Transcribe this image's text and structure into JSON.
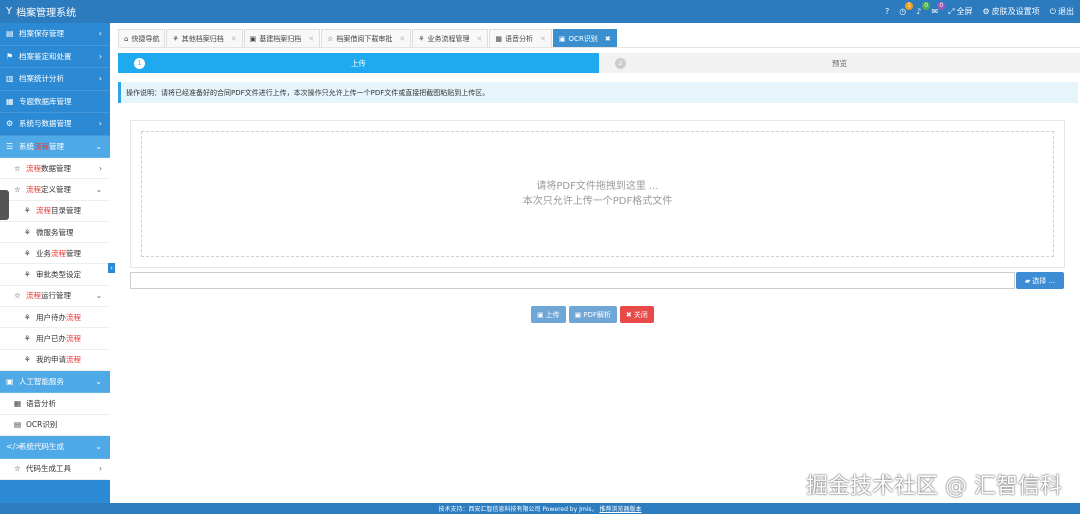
{
  "app": {
    "title": "档案管理系统",
    "logo_icon": "Y"
  },
  "topbar": {
    "items": [
      {
        "icon": "question-icon",
        "label": "",
        "badge": ""
      },
      {
        "icon": "clock-icon",
        "label": "",
        "badge": "1",
        "badge_color": "#f0a020"
      },
      {
        "icon": "bell-icon",
        "label": "",
        "badge": "0",
        "badge_color": "#4caf50"
      },
      {
        "icon": "mail-icon",
        "label": "",
        "badge": "0",
        "badge_color": "#9b59b6"
      },
      {
        "icon": "fullscreen-icon",
        "label": "全屏"
      },
      {
        "icon": "gear-icon",
        "label": "皮肤及设置项"
      },
      {
        "icon": "power-icon",
        "label": "退出"
      }
    ]
  },
  "sidebar": {
    "items": [
      {
        "label": "档案保存管理",
        "icon": "▤"
      },
      {
        "label": "档案鉴定和处置",
        "icon": "⚑"
      },
      {
        "label": "档案统计分析",
        "icon": "▥"
      },
      {
        "label": "专题数据库管理",
        "icon": "▦"
      },
      {
        "label": "系统与数据管理",
        "icon": "⚙"
      },
      {
        "label_pre": "系统",
        "label_red": "流程",
        "label_post": "管理",
        "icon": "☰"
      }
    ],
    "sub_flow": [
      {
        "pre": "",
        "red": "流程",
        "post": "数据管理",
        "level": 1,
        "icon": "☆"
      },
      {
        "pre": "",
        "red": "流程",
        "post": "定义管理",
        "level": 1,
        "icon": "☆"
      },
      {
        "pre": "",
        "red": "流程",
        "post": "目录管理",
        "level": 2,
        "icon": "⚘"
      },
      {
        "pre": "微服务管理",
        "red": "",
        "post": "",
        "level": 2,
        "icon": "⚘"
      },
      {
        "pre": "业务",
        "red": "流程",
        "post": "管理",
        "level": 2,
        "icon": "⚘"
      },
      {
        "pre": "审批类型设定",
        "red": "",
        "post": "",
        "level": 2,
        "icon": "⚘"
      },
      {
        "pre": "",
        "red": "流程",
        "post": "运行管理",
        "level": 1,
        "icon": "☆"
      },
      {
        "pre": "用户待办",
        "red": "流程",
        "post": "",
        "level": 2,
        "icon": "⚘"
      },
      {
        "pre": "用户已办",
        "red": "流程",
        "post": "",
        "level": 2,
        "icon": "⚘"
      },
      {
        "pre": "我的申请",
        "red": "流程",
        "post": "",
        "level": 2,
        "icon": "⚘"
      }
    ],
    "ai_group": {
      "label": "人工智能服务",
      "icon": "▣"
    },
    "ai_items": [
      {
        "label": "语音分析",
        "icon": "▦"
      },
      {
        "label": "OCR识别",
        "icon": "▤"
      }
    ],
    "code_group": {
      "label": "系统代码生成",
      "icon": "</>"
    },
    "code_items": [
      {
        "label": "代码生成工具",
        "icon": "☆"
      }
    ]
  },
  "tabs": [
    {
      "label": "快捷导航",
      "icon": "⌂",
      "closable": false
    },
    {
      "label": "其他档案归档",
      "icon": "⚘",
      "closable": true
    },
    {
      "label": "基建档案归档",
      "icon": "▣",
      "closable": true
    },
    {
      "label": "档案借阅下载审批",
      "icon": "☆",
      "closable": true
    },
    {
      "label": "业务流程管理",
      "icon": "⚘",
      "closable": true
    },
    {
      "label": "语音分析",
      "icon": "▦",
      "closable": true
    },
    {
      "label": "OCR识别",
      "icon": "▣",
      "closable": true,
      "active": true
    }
  ],
  "steps": [
    {
      "num": "1",
      "label": "上传"
    },
    {
      "num": "2",
      "label": "预览"
    }
  ],
  "note": "操作说明：请将已经准备好的合同PDF文件进行上传，本次操作只允许上传一个PDF文件或直接把截图粘贴到上传区。",
  "dropzone": {
    "line1": "请将PDF文件拖拽到这里 ...",
    "line2": "本次只允许上传一个PDF格式文件"
  },
  "file_input": {
    "value": "",
    "choose_label": "选择 ..."
  },
  "buttons": {
    "upload": "上传",
    "pdf_parse": "PDF解析",
    "close": "关闭"
  },
  "footer": {
    "text": "技术支持：西安汇智信息科技有限公司 Powered by Jmis，",
    "link": "推荐浏览器版本"
  },
  "watermark": "掘金技术社区 @ 汇智信科"
}
